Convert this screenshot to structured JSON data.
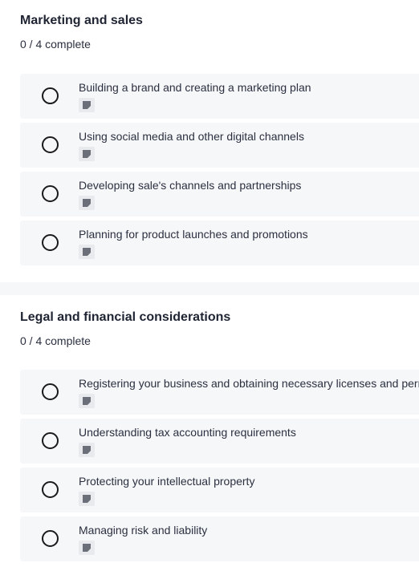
{
  "sections": [
    {
      "title": "Marketing and sales",
      "progress": "0 / 4 complete",
      "items": [
        {
          "label": "Building a brand and creating a marketing plan"
        },
        {
          "label": "Using social media and other digital channels"
        },
        {
          "label": "Developing sale's channels and partnerships"
        },
        {
          "label": "Planning for product launches and promotions"
        }
      ]
    },
    {
      "title": "Legal and financial considerations",
      "progress": "0 / 4 complete",
      "items": [
        {
          "label": "Registering your business and obtaining necessary licenses and permits"
        },
        {
          "label": "Understanding tax accounting requirements"
        },
        {
          "label": "Protecting your intellectual property"
        },
        {
          "label": "Managing risk and liability"
        }
      ]
    }
  ],
  "icons": {
    "item_status": "radio-circle-icon",
    "item_attachment": "note-icon"
  },
  "colors": {
    "item_background": "#f6f7f9",
    "note_icon": "#6b6f7a",
    "radio_border": "#1a1a1a",
    "text": "#1f2433"
  }
}
